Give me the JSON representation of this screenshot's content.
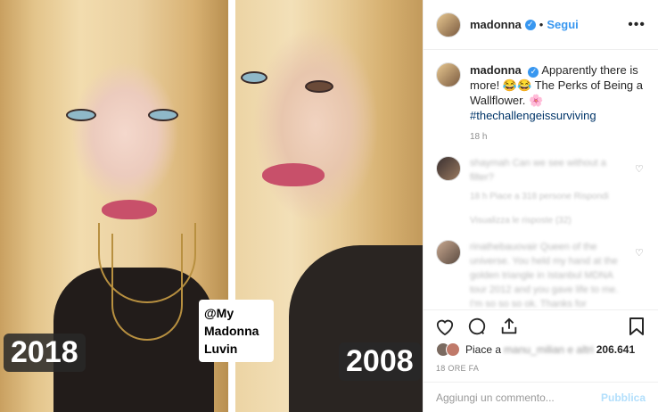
{
  "media": {
    "left_year": "2018",
    "right_year": "2008",
    "handle_tag": "@My Madonna Luvin"
  },
  "header": {
    "username": "madonna",
    "separator": "•",
    "follow_label": "Segui",
    "more_icon": "more-horizontal-icon"
  },
  "caption": {
    "username": "madonna",
    "text": "Apparently there is more! 😂😂 The Perks of Being a Wallflower. 🌸",
    "hashtag": "#thechallengeissurviving",
    "time": "18 h"
  },
  "comments": [
    {
      "text": "shaymah Can we see without a filter?",
      "meta": "18 h     Piace a 318 persone     Rispondi"
    },
    {
      "text": "rinathebauovair Queen of the universe. You held my hand at the golden triangle in Istanbul MDNA tour 2012 and you gave life to me. I'm so so so ok. Thanks for"
    }
  ],
  "replies_text": "Visualizza le risposte (32)",
  "likes": {
    "prefix": "Piace a",
    "blurred_names": "manu_milian e altri",
    "count": "206.641"
  },
  "posted": "18 ORE FA",
  "composer": {
    "placeholder": "Aggiungi un commento...",
    "publish_label": "Pubblica"
  },
  "colors": {
    "link_blue": "#3897f0",
    "hashtag": "#003569",
    "publish_disabled": "#b2dffc"
  }
}
